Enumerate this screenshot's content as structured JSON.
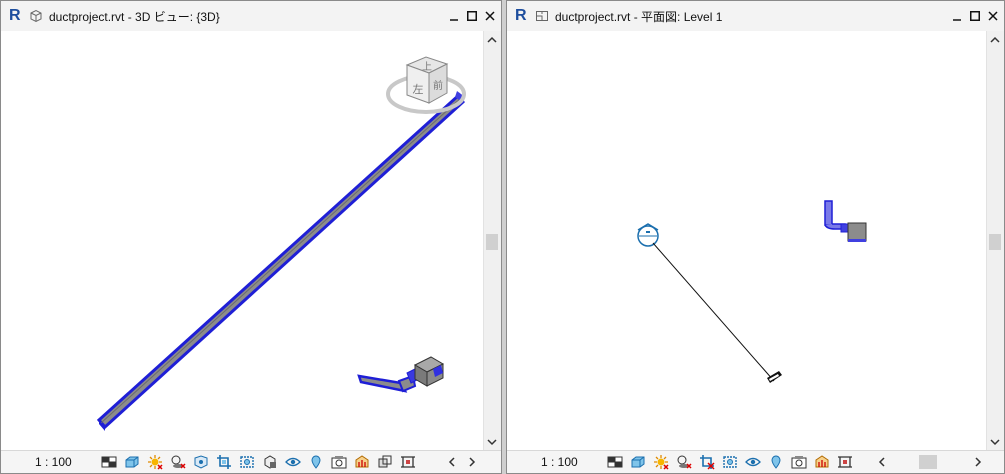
{
  "left_window": {
    "title": "ductproject.rvt - 3D ビュー: {3D}",
    "app_logo": "R",
    "view_icon": "3d-view-icon",
    "scale": "1 : 100",
    "viewcube": {
      "top_face": "上",
      "front_face": "左",
      "right_face": "前"
    }
  },
  "right_window": {
    "title": "ductproject.rvt - 平面図: Level 1",
    "app_logo": "R",
    "view_icon": "floor-plan-icon",
    "scale": "1 : 100"
  },
  "colors": {
    "duct_blue": "#1f1fd6",
    "duct_gray": "#8c8c8c",
    "logo_blue": "#1e4e9e"
  }
}
